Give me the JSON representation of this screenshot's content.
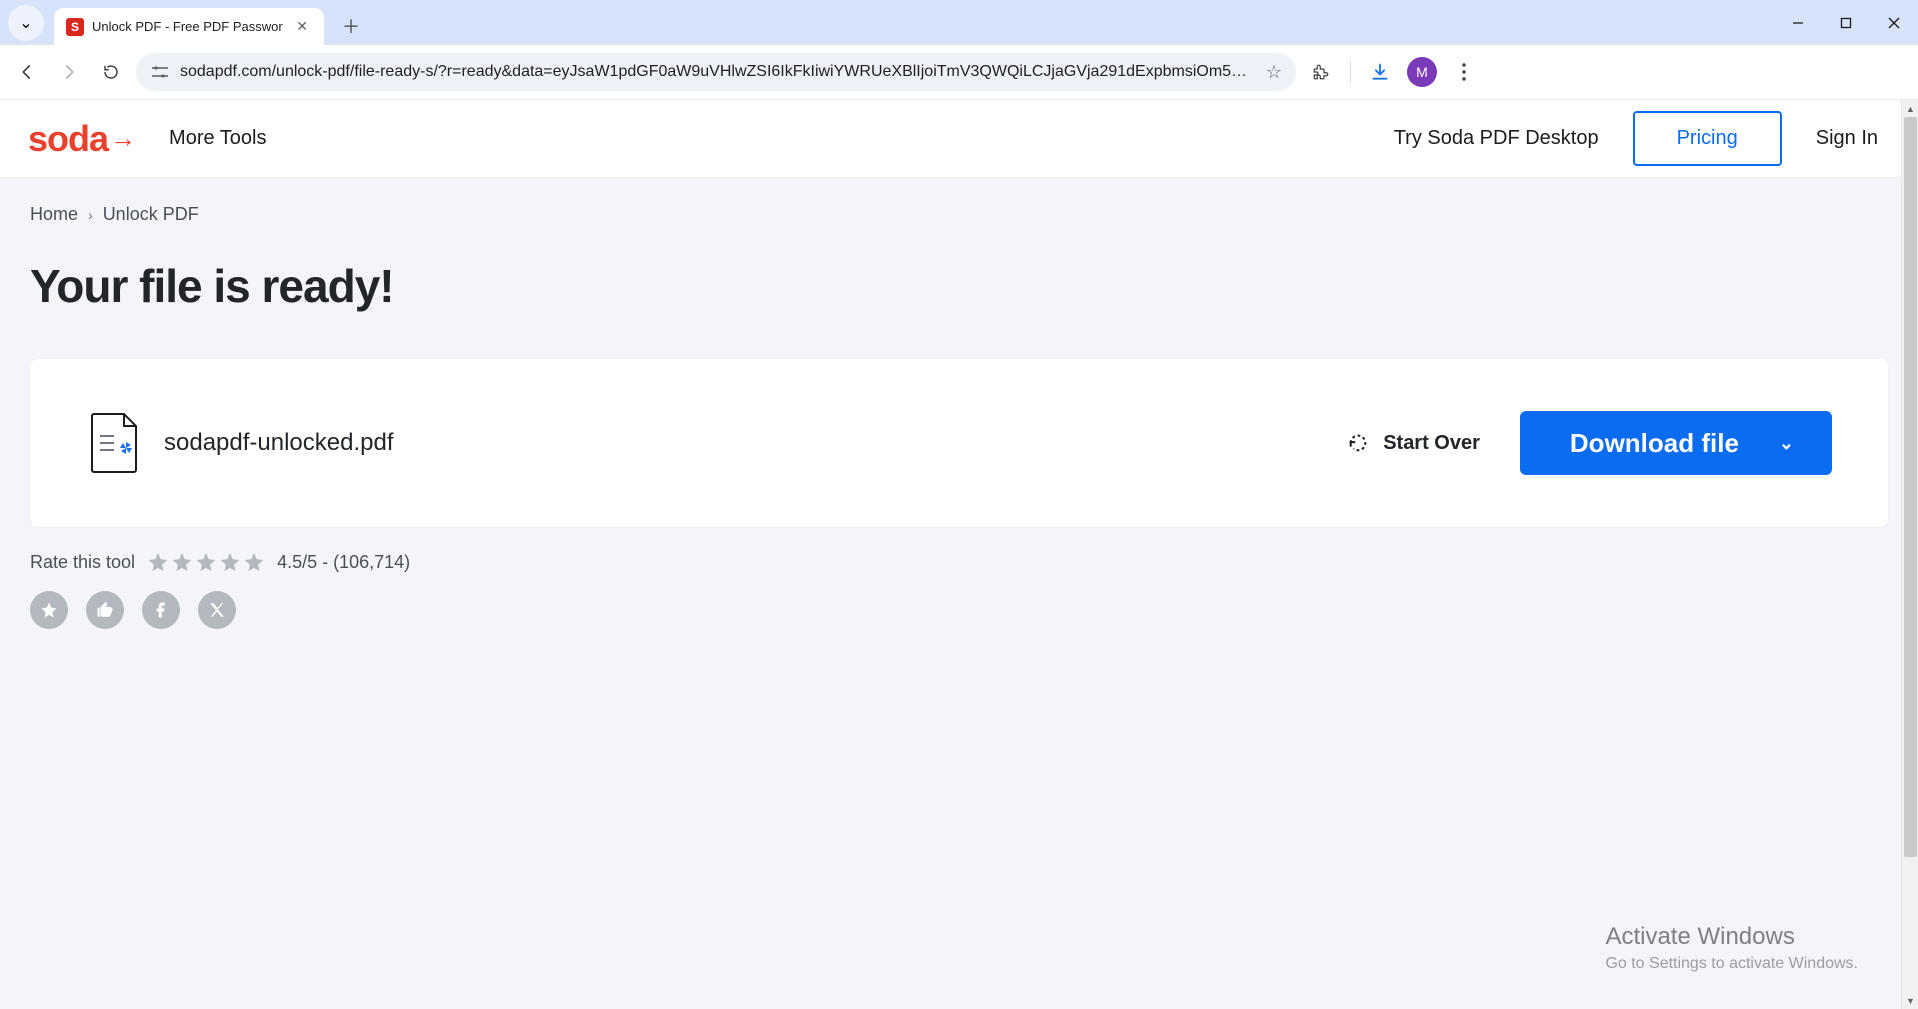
{
  "browser": {
    "tab_search_glyph": "⌄",
    "tab": {
      "favicon_letter": "S",
      "title": "Unlock PDF - Free PDF Passwor"
    },
    "url": "sodapdf.com/unlock-pdf/file-ready-s/?r=ready&data=eyJsaW1pdGF0aW9uVHlwZSI6IkFkIiwiYWRUeXBlIjoiTmV3QWQiLCJjaGVja291dExpbmsiOm5…",
    "avatar_letter": "M"
  },
  "header": {
    "logo_text": "soda",
    "more_tools": "More Tools",
    "try_desktop": "Try Soda PDF Desktop",
    "pricing": "Pricing",
    "sign_in": "Sign In"
  },
  "breadcrumb": {
    "home": "Home",
    "current": "Unlock PDF"
  },
  "page": {
    "title": "Your file is ready!",
    "file_name": "sodapdf-unlocked.pdf",
    "start_over": "Start Over",
    "download": "Download file"
  },
  "rating": {
    "label": "Rate this tool",
    "score_text": "4.5/5 - (106,714)"
  },
  "watermark": {
    "line1": "Activate Windows",
    "line2": "Go to Settings to activate Windows."
  }
}
